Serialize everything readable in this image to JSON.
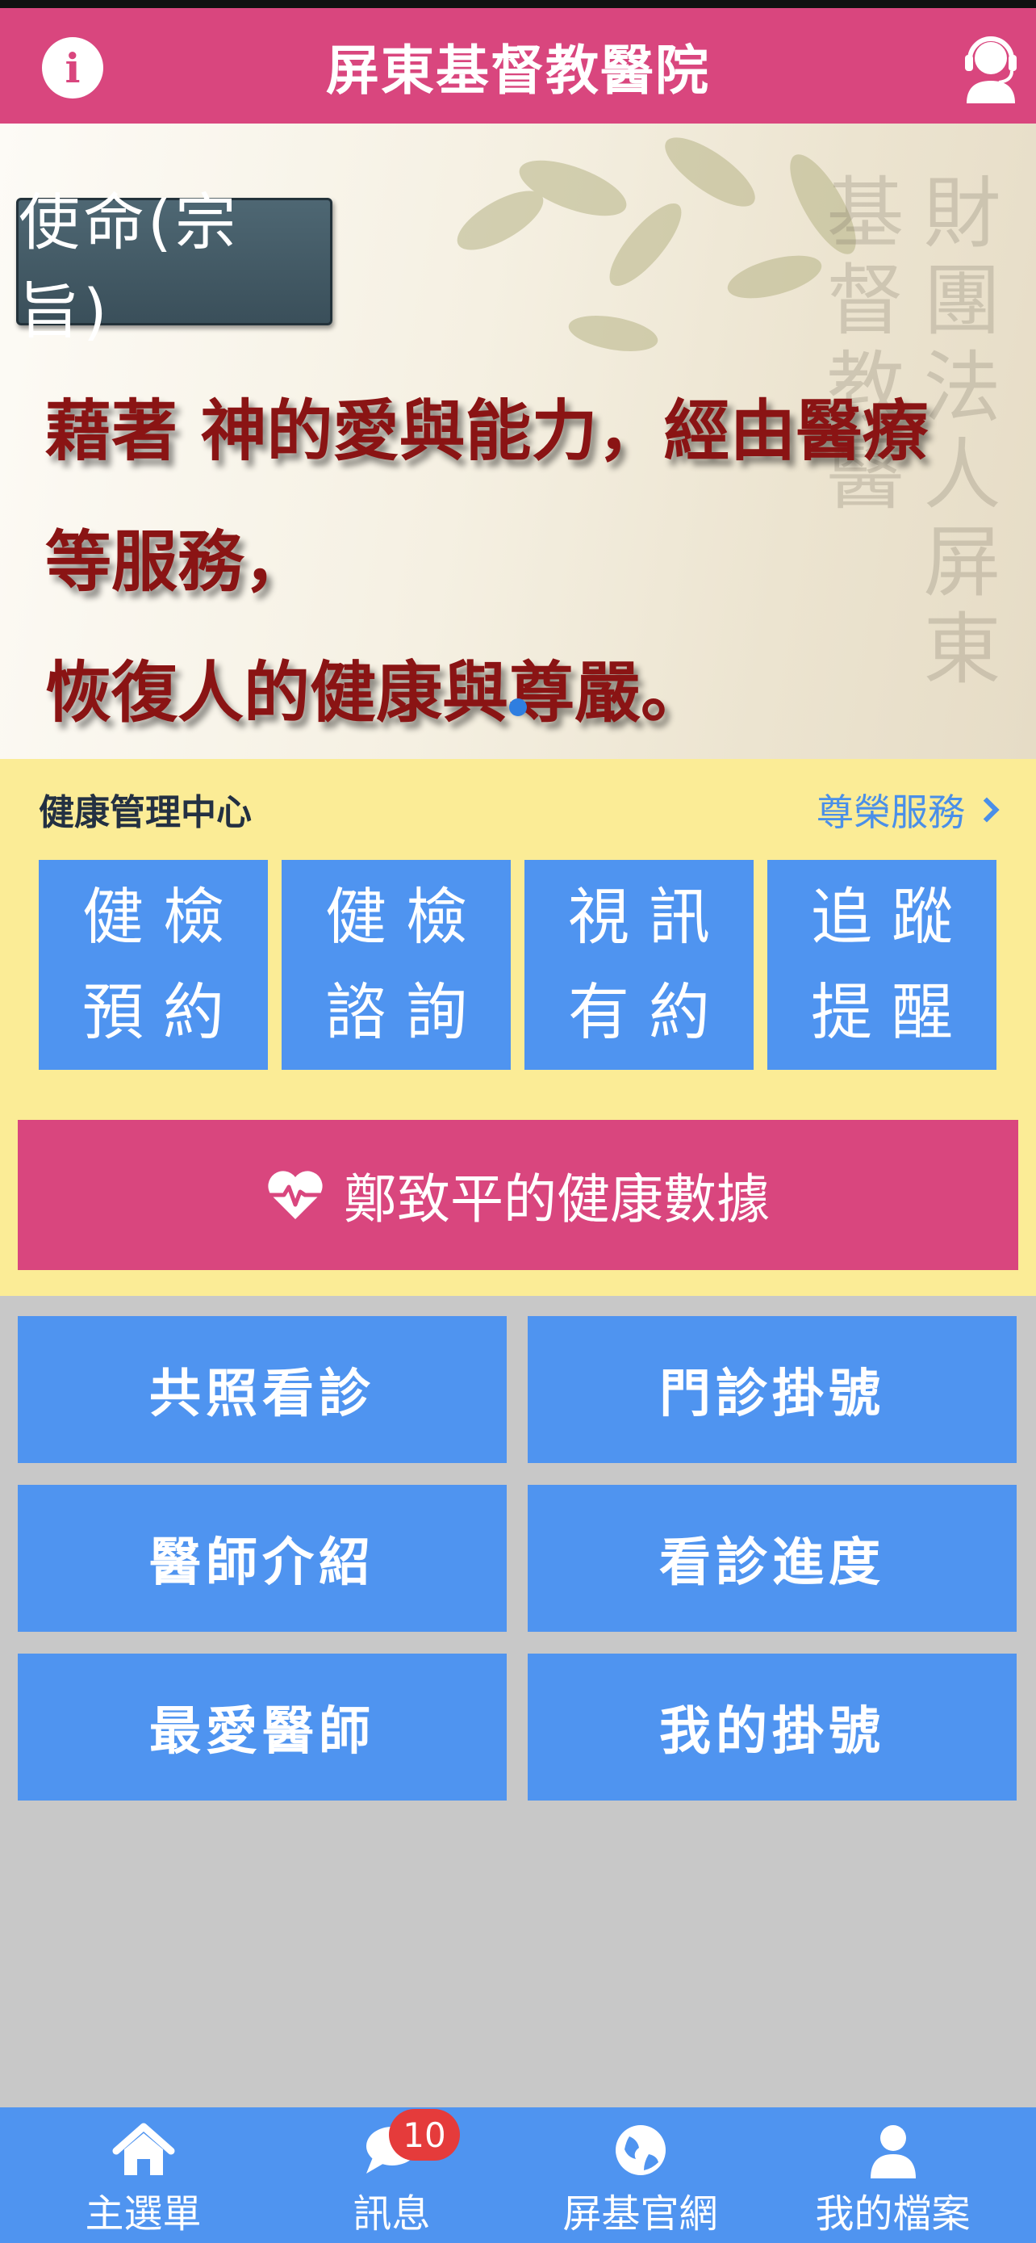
{
  "header": {
    "title": "屏東基督教醫院"
  },
  "banner": {
    "badge": "使命(宗旨)",
    "line1": "藉著 神的愛與能力，經由醫療等服務，",
    "line2": "恢復人的健康與尊嚴。",
    "watermark": "財團法人屏東基督教醫",
    "page_indicator": {
      "pages": 1,
      "active": 1
    }
  },
  "health": {
    "title": "健康管理中心",
    "vip_link": "尊榮服務",
    "tiles": [
      {
        "l1": "健檢",
        "l2": "預約"
      },
      {
        "l1": "健檢",
        "l2": "諮詢"
      },
      {
        "l1": "視訊",
        "l2": "有約"
      },
      {
        "l1": "追蹤",
        "l2": "提醒"
      }
    ],
    "data_button": "鄭致平的健康數據"
  },
  "services": [
    "共照看診",
    "門診掛號",
    "醫師介紹",
    "看診進度",
    "最愛醫師",
    "我的掛號"
  ],
  "nav": {
    "items": [
      "主選單",
      "訊息",
      "屏基官網",
      "我的檔案"
    ],
    "message_badge": "10"
  },
  "colors": {
    "header_pink": "#d9467e",
    "tile_blue": "#4f94f0",
    "health_yellow": "#fbec96",
    "body_gray": "#c8c8c8",
    "badge_red": "#e53b3b"
  }
}
